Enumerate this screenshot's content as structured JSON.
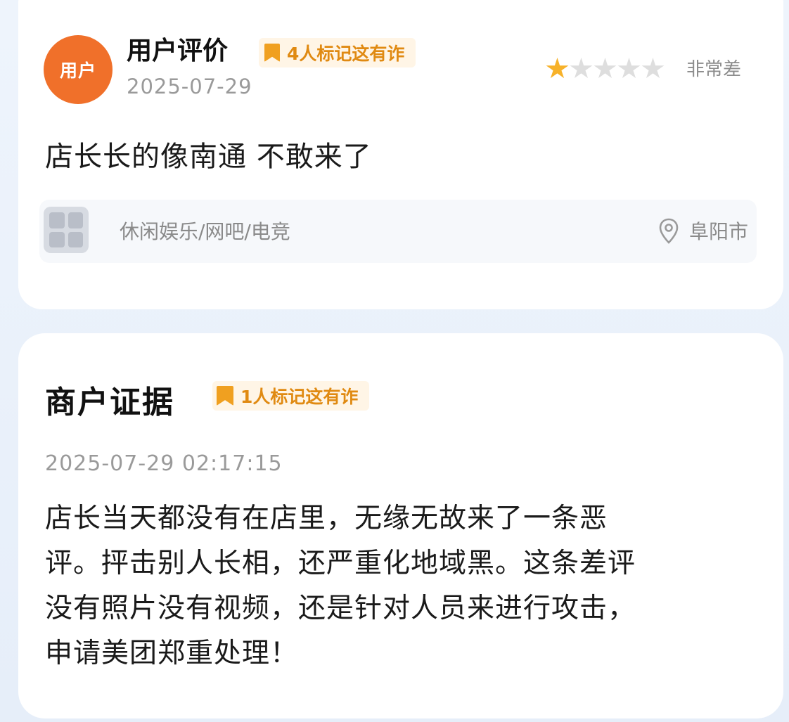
{
  "review": {
    "avatar_text": "用户",
    "user_name": "用户评价",
    "fraud_flag": "4人标记这有诈",
    "date": "2025-07-29",
    "rating": {
      "value": 1,
      "max": 5,
      "label": "非常差"
    },
    "content": "店长长的像南通 不敢来了",
    "shop": {
      "category": "休闲娱乐/网吧/电竞",
      "city": "阜阳市",
      "location_icon": "location-pin-icon"
    }
  },
  "merchant_evidence": {
    "title": "商户证据",
    "fraud_flag": "1人标记这有诈",
    "datetime": "2025-07-29 02:17:15",
    "lines": [
      "店长当天都没有在店里，无缘无故来了一条恶",
      "评。抨击别人长相，还严重化地域黑。这条差评",
      "没有照片没有视频，还是针对人员来进行攻击，",
      "申请美团郑重处理！"
    ]
  },
  "colors": {
    "accent_orange": "#f0702a",
    "flag_orange": "#f0a020",
    "star_gold": "#f7b22a",
    "muted_text": "#9a9a9a"
  }
}
